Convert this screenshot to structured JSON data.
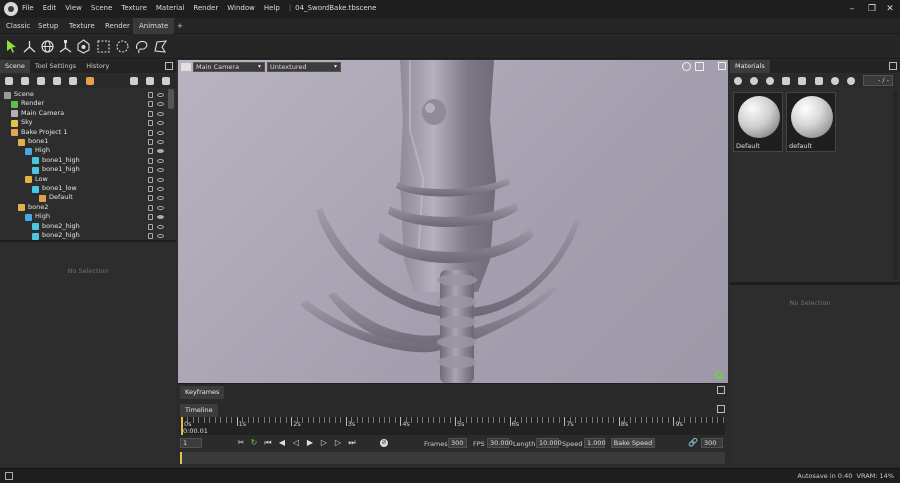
{
  "titlebar": {
    "menu": [
      "File",
      "Edit",
      "View",
      "Scene",
      "Texture",
      "Material",
      "Render",
      "Window",
      "Help"
    ],
    "document": "04_SwordBake.tbscene"
  },
  "modes": [
    "Classic",
    "Setup",
    "Texture",
    "Render",
    "Animate"
  ],
  "active_mode": "Animate",
  "left_panel": {
    "tabs": [
      "Scene",
      "Tool Settings",
      "History"
    ],
    "active_tab": "Scene",
    "tree": [
      {
        "label": "Scene",
        "depth": 0,
        "icon": "scene-icon",
        "color": "#9a9a9a"
      },
      {
        "label": "Render",
        "depth": 1,
        "icon": "render-icon",
        "color": "#5fbf4b"
      },
      {
        "label": "Main Camera",
        "depth": 1,
        "icon": "camera-icon",
        "color": "#b0b0b0"
      },
      {
        "label": "Sky",
        "depth": 1,
        "icon": "sky-icon",
        "color": "#e0c34a"
      },
      {
        "label": "Bake Project 1",
        "depth": 1,
        "icon": "bake-project-icon",
        "color": "#e5a35a"
      },
      {
        "label": "bone1",
        "depth": 2,
        "icon": "folder-icon",
        "color": "#e0b04a"
      },
      {
        "label": "High",
        "depth": 3,
        "icon": "group-icon",
        "color": "#4aa7e0"
      },
      {
        "label": "bone1_high",
        "depth": 4,
        "icon": "mesh-icon",
        "color": "#4ac7e0"
      },
      {
        "label": "bone1_high",
        "depth": 4,
        "icon": "mesh-icon",
        "color": "#4ac7e0"
      },
      {
        "label": "Low",
        "depth": 3,
        "icon": "group-icon",
        "color": "#e0b04a"
      },
      {
        "label": "bone1_low",
        "depth": 4,
        "icon": "mesh-icon",
        "color": "#4ac7e0"
      },
      {
        "label": "Default",
        "depth": 5,
        "icon": "material-icon",
        "color": "#e0a04a"
      },
      {
        "label": "bone2",
        "depth": 2,
        "icon": "folder-icon",
        "color": "#e0b04a"
      },
      {
        "label": "High",
        "depth": 3,
        "icon": "group-icon",
        "color": "#4aa7e0"
      },
      {
        "label": "bone2_high",
        "depth": 4,
        "icon": "mesh-icon",
        "color": "#4ac7e0"
      },
      {
        "label": "bone2_high",
        "depth": 4,
        "icon": "mesh-icon",
        "color": "#4ac7e0"
      }
    ],
    "properties_empty": "No Selection"
  },
  "viewport": {
    "camera": "Main Camera",
    "shading": "Untextured"
  },
  "materials_panel": {
    "title": "Materials",
    "page_indicator": "- / -",
    "materials": [
      {
        "name": "Default",
        "style": "textured"
      },
      {
        "name": "default",
        "style": "smooth"
      }
    ],
    "properties_empty": "No Selection"
  },
  "keyframes": {
    "title": "Keyframes"
  },
  "timeline": {
    "title": "Timeline",
    "current_time": "0:00.01",
    "seconds": [
      "0s",
      "1s",
      "2s",
      "3s",
      "4s",
      "5s",
      "6s",
      "7s",
      "8s",
      "9s"
    ],
    "current_frame": "1",
    "frames_label": "Frames",
    "frames": "300",
    "fps_label": "FPS",
    "fps": "30.000",
    "length_label": "Length",
    "length": "10.000",
    "speed_label": "Speed",
    "speed": "1.000",
    "bake_speed": "Bake Speed",
    "end_frame": "300"
  },
  "status": {
    "autosave": "Autosave in 0:40",
    "vram": "VRAM: 14%"
  }
}
